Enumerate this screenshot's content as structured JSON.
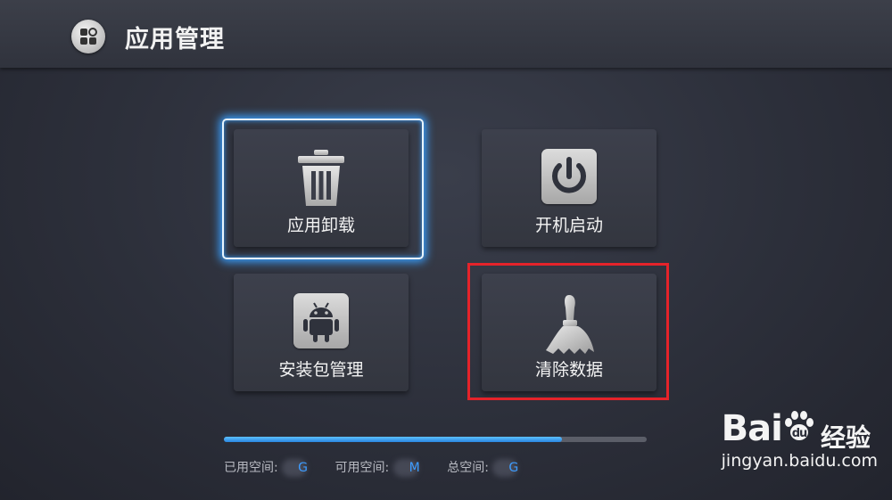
{
  "header": {
    "title": "应用管理",
    "icon": "app-grid-icon"
  },
  "tiles": [
    {
      "label": "应用卸载",
      "icon": "trash-icon",
      "focused": true
    },
    {
      "label": "开机启动",
      "icon": "power-icon"
    },
    {
      "label": "安装包管理",
      "icon": "android-icon"
    },
    {
      "label": "清除数据",
      "icon": "broom-icon",
      "annotated": true
    }
  ],
  "storage": {
    "used_fraction": 0.8,
    "used_label": "已用空间:",
    "used_unit": "G",
    "available_label": "可用空间:",
    "available_unit": "M",
    "total_label": "总空间:",
    "total_unit": "G"
  },
  "watermark": {
    "logo": "Baidu",
    "logo_left": "Bai",
    "logo_right": "du",
    "cn": "经验",
    "url": "jingyan.baidu.com"
  },
  "colors": {
    "focus": "#3aa0ff",
    "annotation": "#e5232a",
    "progress": "#2a86e0"
  }
}
